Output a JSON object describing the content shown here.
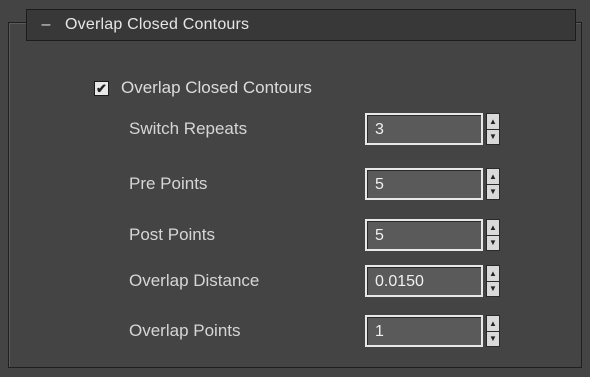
{
  "rollout": {
    "collapse_symbol": "–",
    "title": "Overlap Closed Contours"
  },
  "checkbox": {
    "label": "Overlap Closed Contours",
    "checked": true,
    "check_glyph": "✔"
  },
  "params": [
    {
      "label": "Switch Repeats",
      "value": "3"
    },
    {
      "label": "Pre Points",
      "value": "5"
    },
    {
      "label": "Post Points",
      "value": "5"
    },
    {
      "label": "Overlap Distance",
      "value": "0.0150"
    },
    {
      "label": "Overlap Points",
      "value": "1"
    }
  ],
  "spinner": {
    "up_glyph": "▲",
    "down_glyph": "▼"
  }
}
